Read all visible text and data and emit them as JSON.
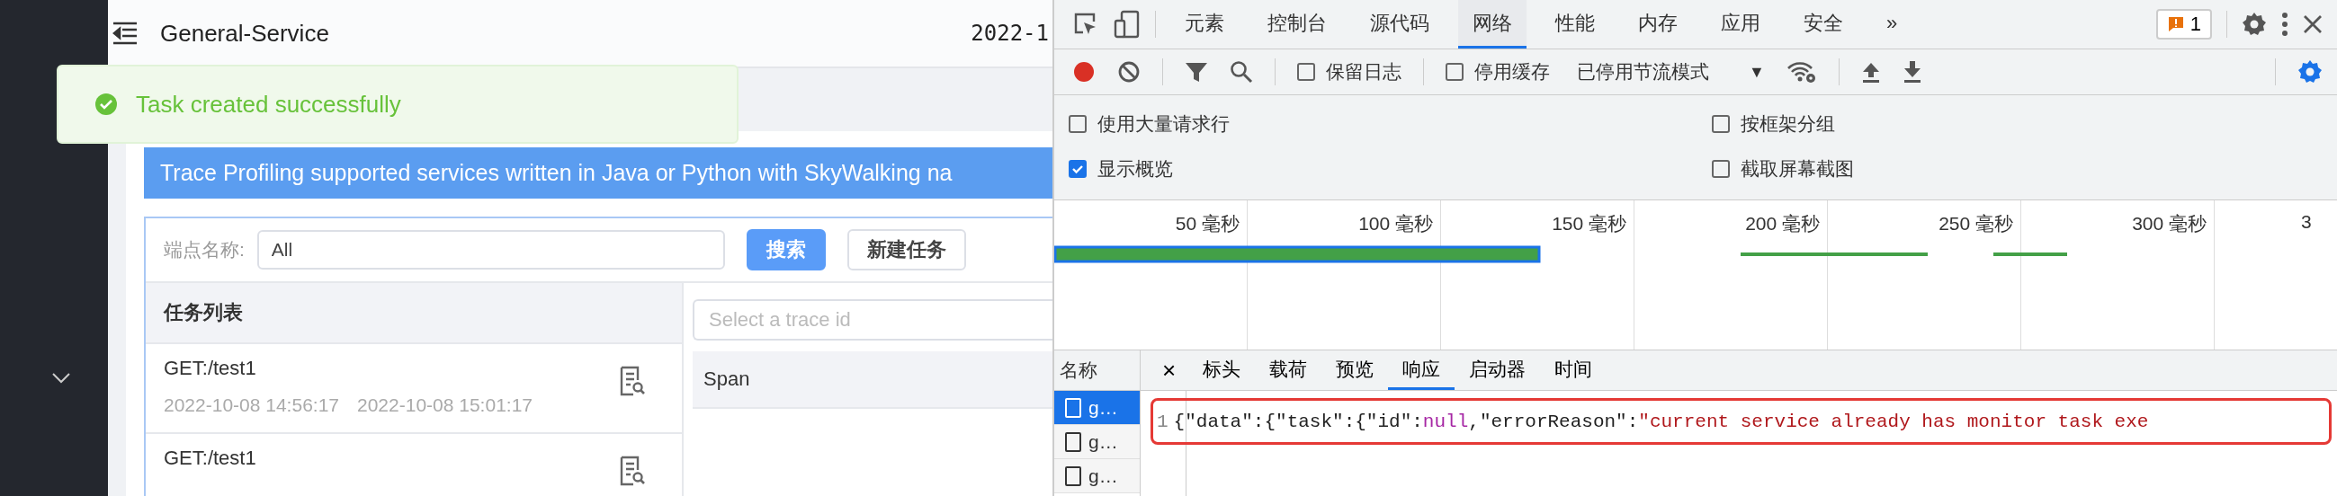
{
  "app": {
    "header": {
      "title": "General-Service",
      "date": "2022-1"
    },
    "toast": {
      "kind": "success",
      "message": "Task created successfully"
    },
    "banner": "Trace Profiling supported services written in Java or Python with SkyWalking na",
    "search": {
      "label": "端点名称:",
      "value": "All",
      "buttons": [
        {
          "label": "搜索",
          "primary": true
        },
        {
          "label": "新建任务",
          "primary": false
        }
      ]
    },
    "task_list": {
      "title": "任务列表",
      "tasks": [
        {
          "endpoint": "GET:/test1",
          "start": "2022-10-08 14:56:17",
          "end": "2022-10-08 15:01:17"
        },
        {
          "endpoint": "GET:/test1"
        }
      ]
    },
    "trace": {
      "placeholder": "Select a trace id",
      "column": "Span"
    }
  },
  "devtools": {
    "tabs": [
      {
        "label": "元素",
        "selected": false
      },
      {
        "label": "控制台",
        "selected": false
      },
      {
        "label": "源代码",
        "selected": false
      },
      {
        "label": "网络",
        "selected": true
      },
      {
        "label": "性能",
        "selected": false
      },
      {
        "label": "内存",
        "selected": false
      },
      {
        "label": "应用",
        "selected": false
      },
      {
        "label": "安全",
        "selected": false
      }
    ],
    "more": "»",
    "issues_count": "1",
    "toolbar": {
      "recording": true,
      "checkboxes": [
        {
          "label": "保留日志",
          "checked": false
        },
        {
          "label": "停用缓存",
          "checked": false
        }
      ],
      "throttle": "已停用节流模式",
      "throttle_arrow": "▼"
    },
    "options": [
      {
        "label": "使用大量请求行",
        "checked": false
      },
      {
        "label": "按框架分组",
        "checked": false
      },
      {
        "label": "显示概览",
        "checked": true
      },
      {
        "label": "截取屏幕截图",
        "checked": false
      }
    ],
    "overview": {
      "ticks": [
        "50 毫秒",
        "100 毫秒",
        "150 毫秒",
        "200 毫秒",
        "250 毫秒",
        "300 毫秒",
        "3"
      ]
    },
    "requests": {
      "header": "名称",
      "items": [
        {
          "name": "g…",
          "selected": true
        },
        {
          "name": "g…",
          "selected": false
        },
        {
          "name": "g…",
          "selected": false
        }
      ]
    },
    "close": "×",
    "detail_tabs": [
      {
        "label": "标头",
        "selected": false
      },
      {
        "label": "载荷",
        "selected": false
      },
      {
        "label": "预览",
        "selected": false
      },
      {
        "label": "响应",
        "selected": true
      },
      {
        "label": "启动器",
        "selected": false
      },
      {
        "label": "时间",
        "selected": false
      }
    ],
    "response": {
      "line_number": "1",
      "highlighted": true,
      "tokens": [
        {
          "kind": "plain",
          "text": "{\"data\":{\"task\":{\"id\":"
        },
        {
          "kind": "keyword",
          "text": "null"
        },
        {
          "kind": "plain",
          "text": ",\"errorReason\":"
        },
        {
          "kind": "string",
          "text": "\"current service already has monitor task exe"
        }
      ]
    }
  }
}
